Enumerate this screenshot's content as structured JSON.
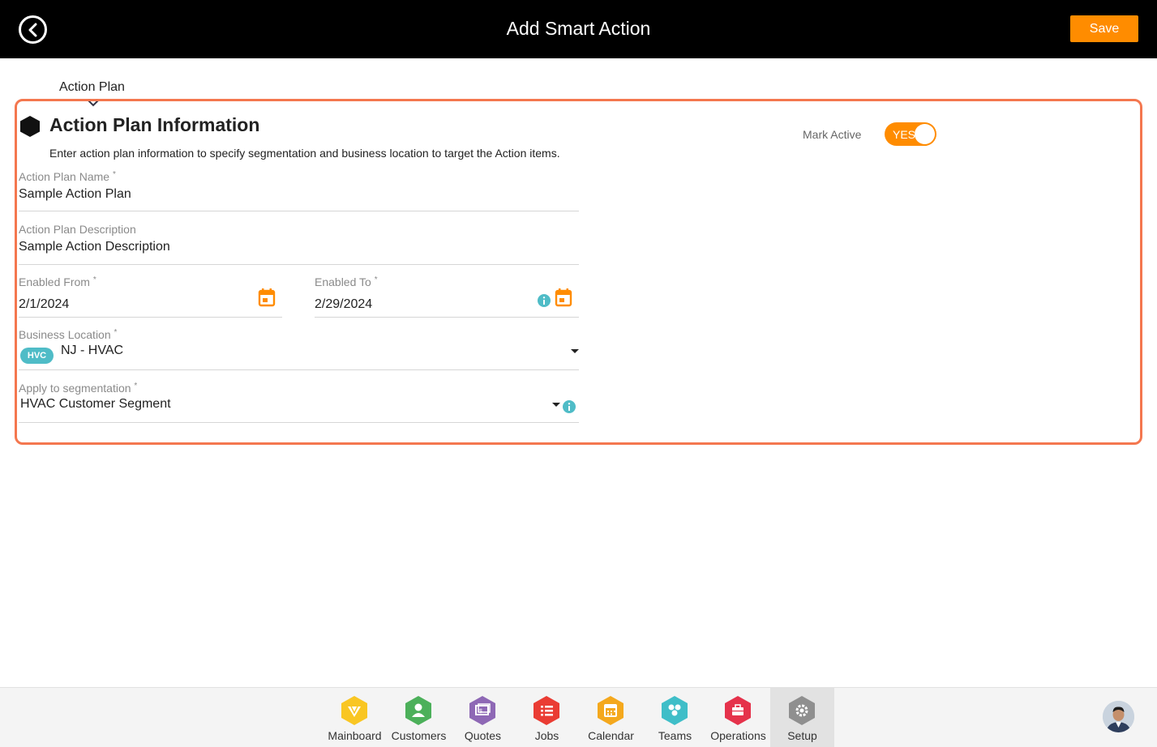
{
  "header": {
    "title": "Add Smart Action",
    "save_label": "Save"
  },
  "tab": {
    "label": "Action Plan"
  },
  "section": {
    "title": "Action Plan Information",
    "description": "Enter action plan information to specify segmentation and business location to target the Action items.",
    "mark_active_label": "Mark Active",
    "toggle_label": "YES"
  },
  "form": {
    "name": {
      "label": "Action Plan Name",
      "required": "*",
      "value": "Sample Action Plan"
    },
    "description": {
      "label": "Action Plan Description",
      "value": "Sample Action Description"
    },
    "enabled_from": {
      "label": "Enabled From",
      "required": "*",
      "value": "2/1/2024"
    },
    "enabled_to": {
      "label": "Enabled To",
      "required": "*",
      "value": "2/29/2024"
    },
    "business_location": {
      "label": "Business Location",
      "required": "*",
      "chip": "HVC",
      "value": "NJ - HVAC"
    },
    "segmentation": {
      "label": "Apply to segmentation",
      "required": "*",
      "value": "HVAC Customer Segment"
    }
  },
  "nav": {
    "items": [
      {
        "label": "Mainboard",
        "color": "#f9c623",
        "icon": "mainboard-icon"
      },
      {
        "label": "Customers",
        "color": "#4cb05a",
        "icon": "customers-icon"
      },
      {
        "label": "Quotes",
        "color": "#8e68b5",
        "icon": "quotes-icon"
      },
      {
        "label": "Jobs",
        "color": "#ea3c33",
        "icon": "jobs-icon"
      },
      {
        "label": "Calendar",
        "color": "#f4a81d",
        "icon": "calendar-icon"
      },
      {
        "label": "Teams",
        "color": "#3fbec8",
        "icon": "teams-icon"
      },
      {
        "label": "Operations",
        "color": "#e5324b",
        "icon": "operations-icon"
      },
      {
        "label": "Setup",
        "color": "#8f8f8f",
        "icon": "gear-icon"
      }
    ]
  },
  "colors": {
    "accent": "#ff8c00",
    "card_border": "#f4774f",
    "chip": "#4fbcc7"
  }
}
